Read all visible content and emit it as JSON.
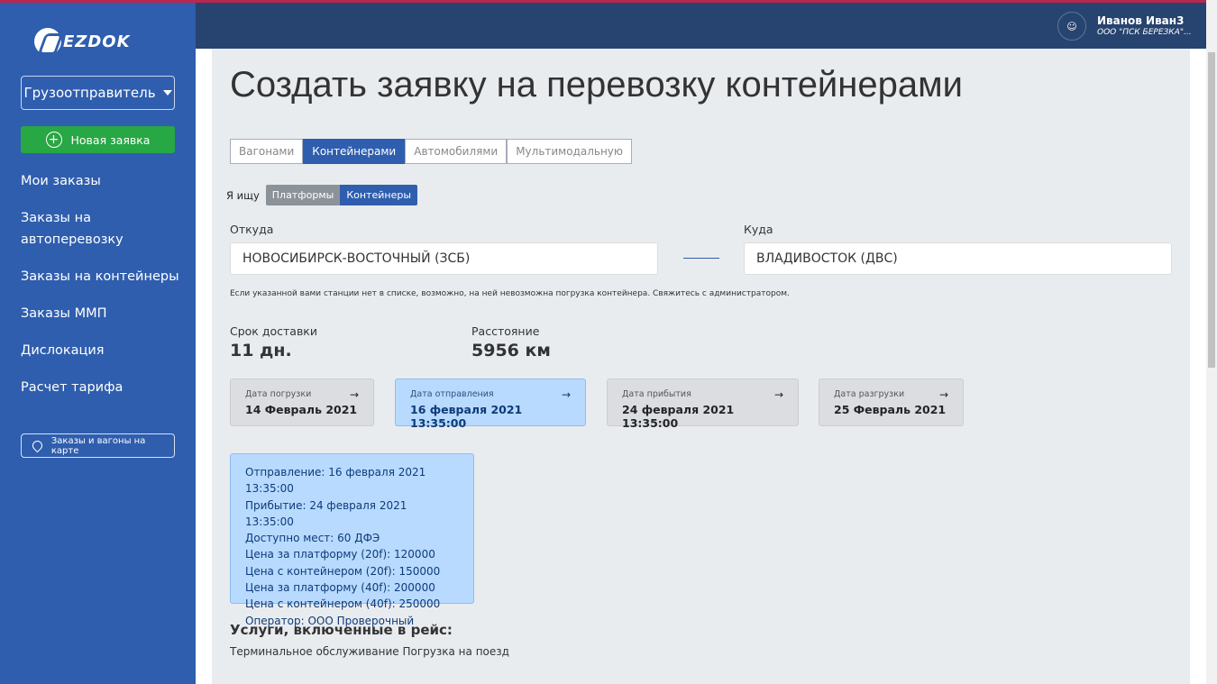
{
  "logo": "EZDOK",
  "sidebar": {
    "role": "Грузоотправитель",
    "new_order": "Новая заявка",
    "items": [
      "Мои заказы",
      "Заказы на автоперевозку",
      "Заказы на контейнеры",
      "Заказы ММП",
      "Дислокация",
      "Расчет тарифа"
    ],
    "map_button": "Заказы и вагоны на карте"
  },
  "user": {
    "name": "Иванов Иван3",
    "org": "ООО \"ПСК БЕРЕЗКА\"..."
  },
  "page_title": "Создать заявку на перевозку контейнерами",
  "tabs": [
    "Вагонами",
    "Контейнерами",
    "Автомобилями",
    "Мультимодальную"
  ],
  "seek": {
    "label": "Я ищу",
    "options": [
      "Платформы",
      "Контейнеры"
    ]
  },
  "from": {
    "label": "Откуда",
    "value": "НОВОСИБИРСК-ВОСТОЧНЫЙ (ЗСБ)"
  },
  "to": {
    "label": "Куда",
    "value": "ВЛАДИВОСТОК (ДВС)"
  },
  "hint": "Если указанной вами станции нет в списке, возможно, на ней невозможна погрузка контейнера. Свяжитесь с администратором.",
  "delivery": {
    "label": "Срок доставки",
    "value": "11 дн."
  },
  "distance": {
    "label": "Расстояние",
    "value": "5956 км"
  },
  "dates": [
    {
      "title": "Дата погрузки",
      "value": "14 Февраль 2021"
    },
    {
      "title": "Дата отправления",
      "value": "16 февраля 2021 13:35:00"
    },
    {
      "title": "Дата прибытия",
      "value": "24 февраля 2021 13:35:00"
    },
    {
      "title": "Дата разгрузки",
      "value": "25 Февраль 2021"
    }
  ],
  "info": [
    "Отправление: 16 февраля 2021 13:35:00",
    "Прибытие: 24 февраля 2021 13:35:00",
    "Доступно мест: 60 ДФЭ",
    "Цена за платформу (20f): 120000",
    "Цена с контейнером (20f): 150000",
    "Цена за платформу (40f): 200000",
    "Цена с контейнером (40f): 250000",
    "Оператор: ООО Проверочный"
  ],
  "services": {
    "title": "Услуги, включенные в рейс:",
    "text": "Терминальное обслуживание Погрузка на поезд"
  }
}
